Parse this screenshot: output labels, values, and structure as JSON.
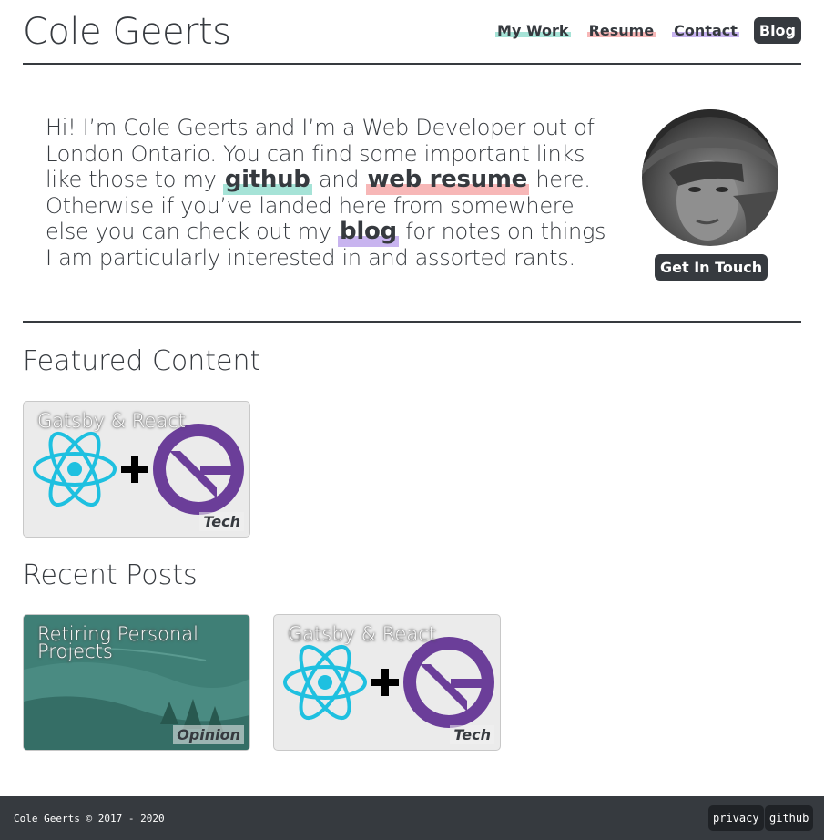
{
  "header": {
    "site_title": "Cole Geerts",
    "nav": [
      {
        "label": "My Work",
        "color": "#a6e3d7"
      },
      {
        "label": "Resume",
        "color": "#f7b7b7"
      },
      {
        "label": "Contact",
        "color": "#c8b4ef"
      }
    ],
    "blog_label": "Blog"
  },
  "intro": {
    "line1": "Hi! I’m Cole Geerts and I’m a Web Developer out of",
    "line2": "London Ontario. You can find some important links",
    "line3_a": "like those to my ",
    "github_link": "github",
    "line3_b": " and ",
    "resume_link": "web resume",
    "line3_c": " here.",
    "line4": "Otherwise if you’ve landed here from somewhere",
    "line5_a": "else you can check out my ",
    "blog_link": "blog",
    "line5_b": " for notes on things",
    "line6": "I am particularly interested in and assorted rants.",
    "github_color": "#a6e3d7",
    "resume_color": "#f7b7b7",
    "blog_color": "#c8b4ef"
  },
  "profile": {
    "get_in_touch_label": "Get In Touch"
  },
  "featured": {
    "title": "Featured Content",
    "cards": [
      {
        "title": "Gatsby & React",
        "tag": "Tech"
      }
    ]
  },
  "recent": {
    "title": "Recent Posts",
    "cards": [
      {
        "title_line1": "Retiring Personal",
        "title_line2": "Projects",
        "tag": "Opinion"
      },
      {
        "title": "Gatsby & React",
        "tag": "Tech"
      }
    ]
  },
  "footer": {
    "copyright": "Cole Geerts © 2017 - 2020",
    "privacy_label": "privacy",
    "github_label": "github"
  },
  "colors": {
    "dark": "#363a3f",
    "react_blue": "#1ec0e0",
    "gatsby_purple": "#6b3e99",
    "green_card": "#3f7f76"
  }
}
